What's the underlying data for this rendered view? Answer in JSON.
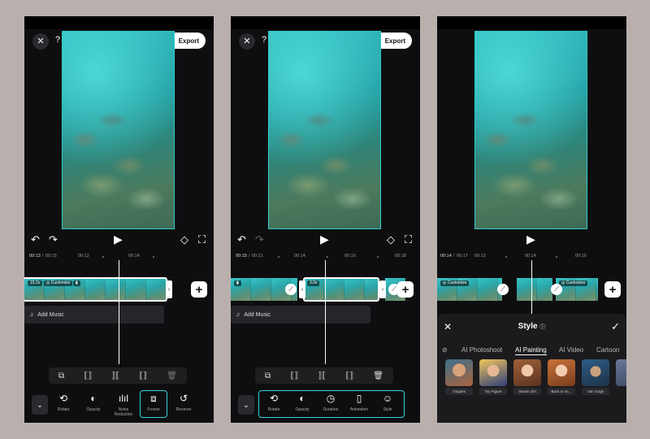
{
  "panel1": {
    "export_label": "Export",
    "ruler": [
      "00:13",
      "00:15",
      "00:12",
      "00:14"
    ],
    "clip_time": "15.2s",
    "clip_customize": "Customize",
    "add_music": "Add Music",
    "tools": [
      {
        "label": "Rotate",
        "icon": "rotate-icon"
      },
      {
        "label": "Opacity",
        "icon": "opacity-icon"
      },
      {
        "label": "Noise Reduction",
        "icon": "noise-reduction-icon"
      },
      {
        "label": "Freeze",
        "icon": "freeze-icon"
      },
      {
        "label": "Reverse",
        "icon": "reverse-icon"
      }
    ]
  },
  "panel2": {
    "export_label": "Export",
    "ruler": [
      "00:15",
      "00:21",
      "00:14",
      "00:16",
      "00:18"
    ],
    "clip_time": "3.0s",
    "add_music": "Add Music",
    "tools": [
      {
        "label": "Rotate",
        "icon": "rotate-icon"
      },
      {
        "label": "Opacity",
        "icon": "opacity-icon"
      },
      {
        "label": "Duration",
        "icon": "duration-icon"
      },
      {
        "label": "Animation",
        "icon": "animation-icon"
      },
      {
        "label": "Style",
        "icon": "style-icon"
      }
    ]
  },
  "panel3": {
    "ruler": [
      "00:14",
      "00:17",
      "00:12",
      "00:14",
      "00:16"
    ],
    "clip_customize_a": "Customize",
    "clip_customize_b": "Customize",
    "style_title": "Style",
    "tabs": [
      "AI Photoshoot",
      "AI Painting",
      "AI Video",
      "Cartoon"
    ],
    "active_tab": "AI Painting",
    "cards": [
      "Origami",
      "Toy Figure",
      "Steam Girl",
      "Back to Sc...",
      "Van Gogh"
    ]
  },
  "colors": {
    "accent": "#34d6dc",
    "background": "#b9b0ae",
    "app_bg": "#0e0e10"
  }
}
